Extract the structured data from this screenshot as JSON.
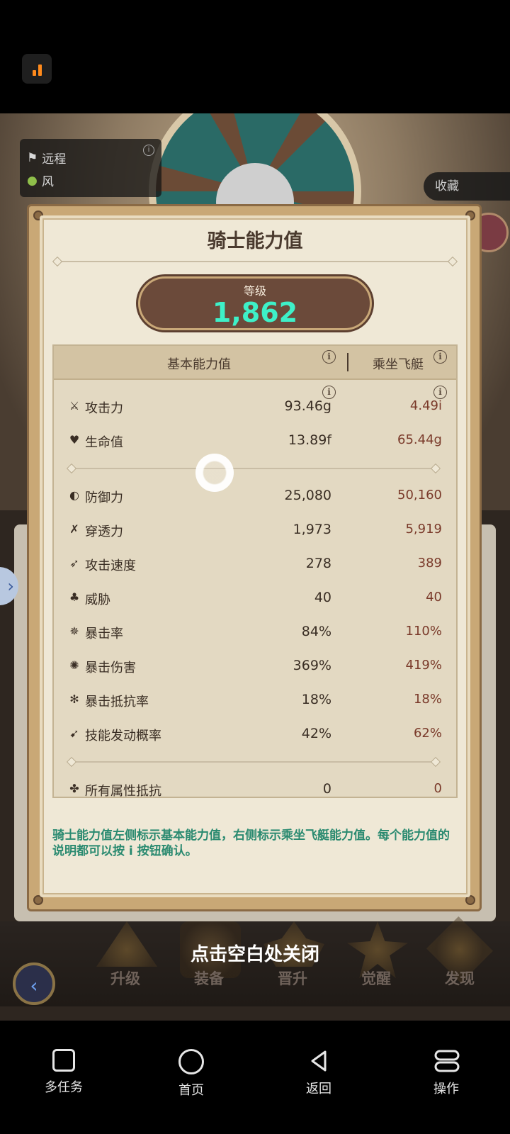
{
  "status": {
    "icon": "signal-icon"
  },
  "scene": {
    "type_label": "远程",
    "element_label": "风",
    "collect_label": "收藏"
  },
  "modal": {
    "title": "骑士能力值",
    "level_label": "等级",
    "level_value": "1,862",
    "col_base": "基本能力值",
    "col_ride": "乘坐飞艇",
    "info_glyph": "i",
    "stats_top": [
      {
        "icon": "sword-icon",
        "label": "攻击力",
        "base": "93.46g",
        "ride": "4.49i"
      },
      {
        "icon": "heart-icon",
        "label": "生命值",
        "base": "13.89f",
        "ride": "65.44g"
      }
    ],
    "stats_mid": [
      {
        "icon": "shield-icon",
        "label": "防御力",
        "base": "25,080",
        "ride": "50,160"
      },
      {
        "icon": "pierce-icon",
        "label": "穿透力",
        "base": "1,973",
        "ride": "5,919"
      },
      {
        "icon": "attack-speed-icon",
        "label": "攻击速度",
        "base": "278",
        "ride": "389"
      },
      {
        "icon": "threat-icon",
        "label": "威胁",
        "base": "40",
        "ride": "40"
      },
      {
        "icon": "crit-rate-icon",
        "label": "暴击率",
        "base": "84%",
        "ride": "110%"
      },
      {
        "icon": "crit-damage-icon",
        "label": "暴击伤害",
        "base": "369%",
        "ride": "419%"
      },
      {
        "icon": "crit-resist-icon",
        "label": "暴击抵抗率",
        "base": "18%",
        "ride": "18%"
      },
      {
        "icon": "skill-trigger-icon",
        "label": "技能发动概率",
        "base": "42%",
        "ride": "62%"
      }
    ],
    "stats_bottom": [
      {
        "icon": "all-resist-icon",
        "label": "所有属性抵抗",
        "base": "0",
        "ride": "0"
      }
    ],
    "note": "骑士能力值左侧标示基本能力值，右侧标示乘坐飞艇能力值。每个能力值的说明都可以按 i 按钮确认。"
  },
  "game_nav": {
    "close_hint": "点击空白处关闭",
    "items": [
      "升级",
      "装备",
      "晋升",
      "觉醒",
      "发现"
    ]
  },
  "system_nav": {
    "items": [
      "多任务",
      "首页",
      "返回",
      "操作"
    ]
  },
  "colors": {
    "level_value": "#3ef0c8",
    "note_text": "#2a8a70",
    "ride_value": "#7a3a2a"
  }
}
